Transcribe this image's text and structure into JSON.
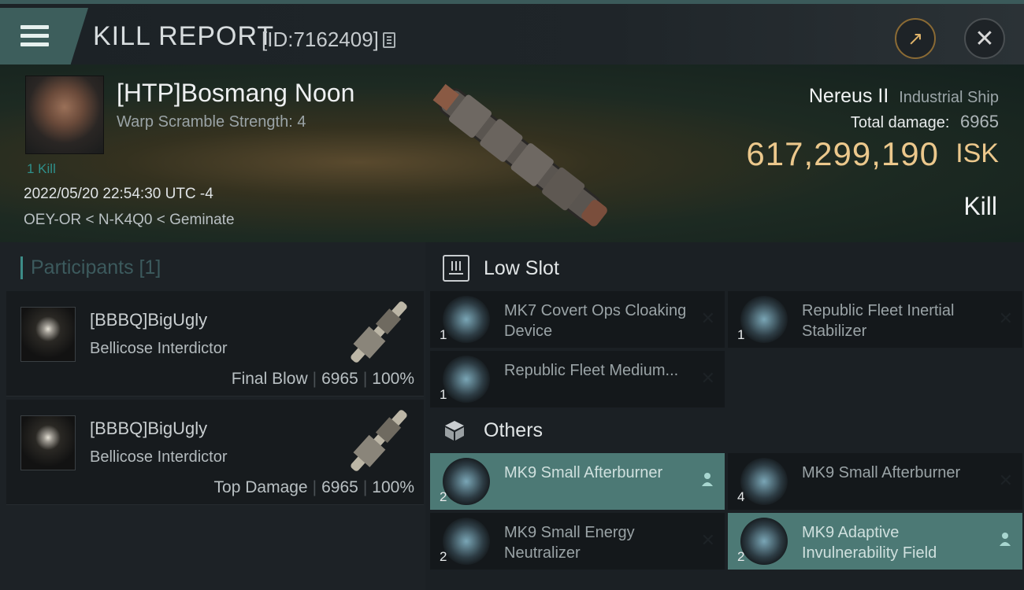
{
  "header": {
    "title": "KILL REPORT",
    "report_id": "[ID:7162409]"
  },
  "victim": {
    "name": "[HTP]Bosmang Noon",
    "warp_scramble": "Warp Scramble Strength: 4",
    "kills_link": "1 Kill",
    "datetime": "2022/05/20 22:54:30 UTC -4",
    "location": "OEY-OR < N-K4Q0 < Geminate",
    "ship_name": "Nereus II",
    "ship_class": "Industrial Ship",
    "total_damage_label": "Total damage:",
    "total_damage": "6965",
    "isk_value": "617,299,190",
    "isk_unit": "ISK",
    "result": "Kill"
  },
  "participants": {
    "header": "Participants [1]",
    "cards": [
      {
        "name": "[BBBQ]BigUgly",
        "ship": "Bellicose Interdictor",
        "tag": "Final Blow",
        "damage": "6965",
        "percent": "100%"
      },
      {
        "name": "[BBBQ]BigUgly",
        "ship": "Bellicose Interdictor",
        "tag": "Top Damage",
        "damage": "6965",
        "percent": "100%"
      }
    ]
  },
  "modules": {
    "low_slot_label": "Low Slot",
    "others_label": "Others",
    "low_slot": [
      {
        "name": "MK7 Covert Ops Cloaking Device",
        "qty": "1",
        "highlight": false
      },
      {
        "name": "Republic Fleet Inertial Stabilizer",
        "qty": "1",
        "highlight": false
      },
      {
        "name": "Republic Fleet Medium...",
        "qty": "1",
        "highlight": false
      }
    ],
    "others": [
      {
        "name": "MK9 Small Afterburner",
        "qty": "2",
        "highlight": true
      },
      {
        "name": "MK9 Small Afterburner",
        "qty": "4",
        "highlight": false
      },
      {
        "name": "MK9 Small Energy Neutralizer",
        "qty": "2",
        "highlight": false
      },
      {
        "name": "MK9 Adaptive Invulnerability Field",
        "qty": "2",
        "highlight": true
      }
    ]
  },
  "colors": {
    "accent_teal": "#4c7975",
    "isk_gold": "#ecc88c"
  }
}
